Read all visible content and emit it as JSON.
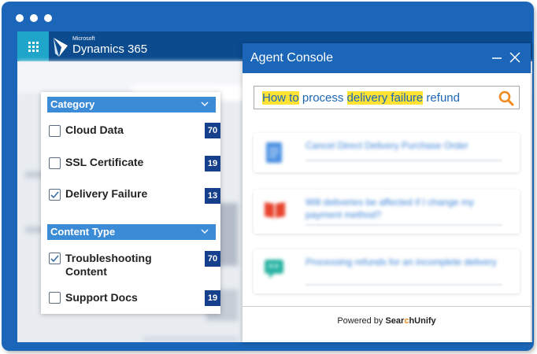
{
  "d365": {
    "brand_small": "Microsoft",
    "brand_big": "Dynamics 365"
  },
  "filters": {
    "groups": [
      {
        "title": "Category",
        "items": [
          {
            "label": "Cloud Data",
            "count": "70",
            "checked": false
          },
          {
            "label": "SSL Certificate",
            "count": "19",
            "checked": false
          },
          {
            "label": "Delivery Failure",
            "count": "13",
            "checked": true
          }
        ]
      },
      {
        "title": "Content Type",
        "items": [
          {
            "label": "Troubleshooting Content",
            "count": "70",
            "checked": true
          },
          {
            "label": "Support Docs",
            "count": "19",
            "checked": false
          }
        ]
      }
    ]
  },
  "console": {
    "title": "Agent Console",
    "query_parts": [
      {
        "text": "How to",
        "highlight": true
      },
      {
        "text": " process ",
        "highlight": false
      },
      {
        "text": "delivery failure",
        "highlight": true
      },
      {
        "text": " refund",
        "highlight": false
      }
    ],
    "results": [
      {
        "title": "Cancel Direct Delivery Purchase Order",
        "icon": "document-icon",
        "color": "#3a82d6"
      },
      {
        "title": "Will deliveries be affected if I change my payment method?",
        "icon": "book-icon",
        "color": "#e8442d"
      },
      {
        "title": "Processing refunds for an incomplete delivery",
        "icon": "chat-icon",
        "color": "#2bb3a3"
      }
    ],
    "powered_prefix": "Powered by",
    "brand_left": "Sear",
    "brand_mid": "c",
    "brand_right": "hUnify"
  },
  "colors": {
    "frame": "#1b66b8",
    "filter_header": "#3c8bd7",
    "count_badge": "#163f8c",
    "highlight": "#ffe234",
    "search_icon": "#f08a1c"
  }
}
